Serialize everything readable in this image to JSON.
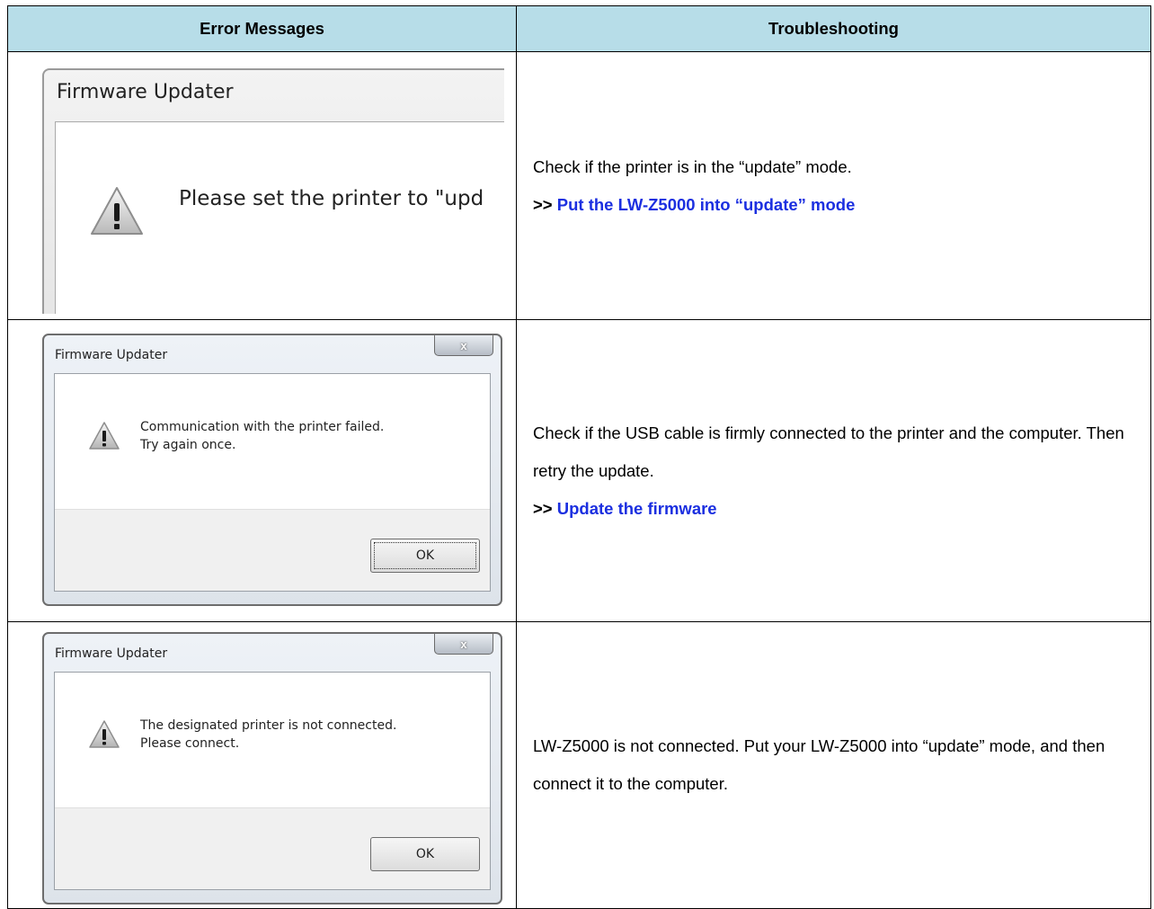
{
  "table": {
    "headers": [
      "Error Messages",
      "Troubleshooting"
    ]
  },
  "rows": [
    {
      "dialog": {
        "title": "Firmware Updater",
        "message": "Please set the printer to \"upd",
        "icon": "warning-icon"
      },
      "trouble": {
        "text": "Check if the printer is in the “update” mode.",
        "link_prefix": ">> ",
        "link_label": "Put the LW-Z5000 into “update” mode"
      }
    },
    {
      "dialog": {
        "title": "Firmware Updater",
        "close_label": "x",
        "message_line1": "Communication with the printer failed.",
        "message_line2": "Try again once.",
        "ok_label": "OK",
        "icon": "warning-icon"
      },
      "trouble": {
        "text": "Check if the USB cable is firmly connected to the printer and the computer. Then retry the update.",
        "link_prefix": ">> ",
        "link_label": "Update the firmware"
      }
    },
    {
      "dialog": {
        "title": "Firmware Updater",
        "close_label": "x",
        "message_line1": "The designated printer is not connected.",
        "message_line2": "Please connect.",
        "ok_label": "OK",
        "icon": "warning-icon"
      },
      "trouble": {
        "text": "LW-Z5000 is not connected. Put your LW-Z5000 into “update” mode, and then connect it to the computer."
      }
    }
  ],
  "colors": {
    "header_bg": "#b7dde8",
    "link": "#1b2fe0"
  }
}
